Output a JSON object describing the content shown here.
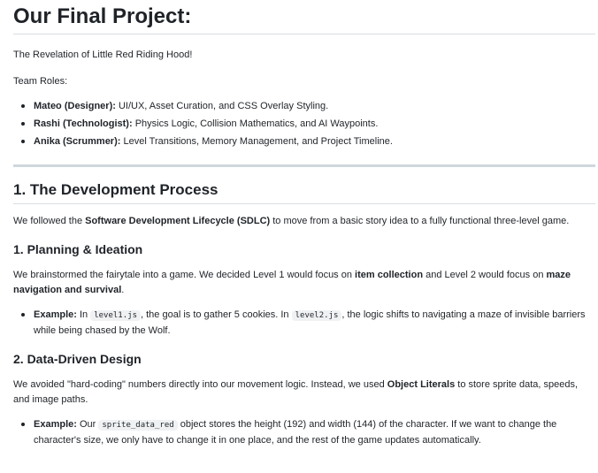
{
  "title": "Our Final Project:",
  "subtitle": "The Revelation of Little Red Riding Hood!",
  "team_roles_label": "Team Roles:",
  "roles": [
    {
      "name": "Mateo (Designer):",
      "desc": "UI/UX, Asset Curation, and CSS Overlay Styling."
    },
    {
      "name": "Rashi (Technologist):",
      "desc": "Physics Logic, Collision Mathematics, and AI Waypoints."
    },
    {
      "name": "Anika (Scrummer):",
      "desc": "Level Transitions, Memory Management, and Project Timeline."
    }
  ],
  "section1": {
    "heading": "1. The Development Process",
    "intro_a": "We followed the ",
    "intro_bold": "Software Development Lifecycle (SDLC)",
    "intro_b": " to move from a basic story idea to a fully functional three-level game."
  },
  "planning": {
    "heading": "1. Planning & Ideation",
    "p_a": "We brainstormed the fairytale into a game. We decided Level 1 would focus on ",
    "p_bold1": "item collection",
    "p_b": " and Level 2 would focus on ",
    "p_bold2": "maze navigation and survival",
    "p_c": ".",
    "example_label": "Example:",
    "ex_a": " In ",
    "code1": "level1.js",
    "ex_b": ", the goal is to gather 5 cookies. In ",
    "code2": "level2.js",
    "ex_c": ", the logic shifts to navigating a maze of invisible barriers while being chased by the Wolf."
  },
  "datadriven": {
    "heading": "2. Data-Driven Design",
    "p_a": "We avoided \"hard-coding\" numbers directly into our movement logic. Instead, we used ",
    "p_bold": "Object Literals",
    "p_b": " to store sprite data, speeds, and image paths.",
    "example_label": "Example:",
    "ex_a": " Our ",
    "code1": "sprite_data_red",
    "ex_b": " object stores the height (192) and width (144) of the character. If we want to change the character's size, we only have to change it in one place, and the rest of the game updates automatically."
  }
}
